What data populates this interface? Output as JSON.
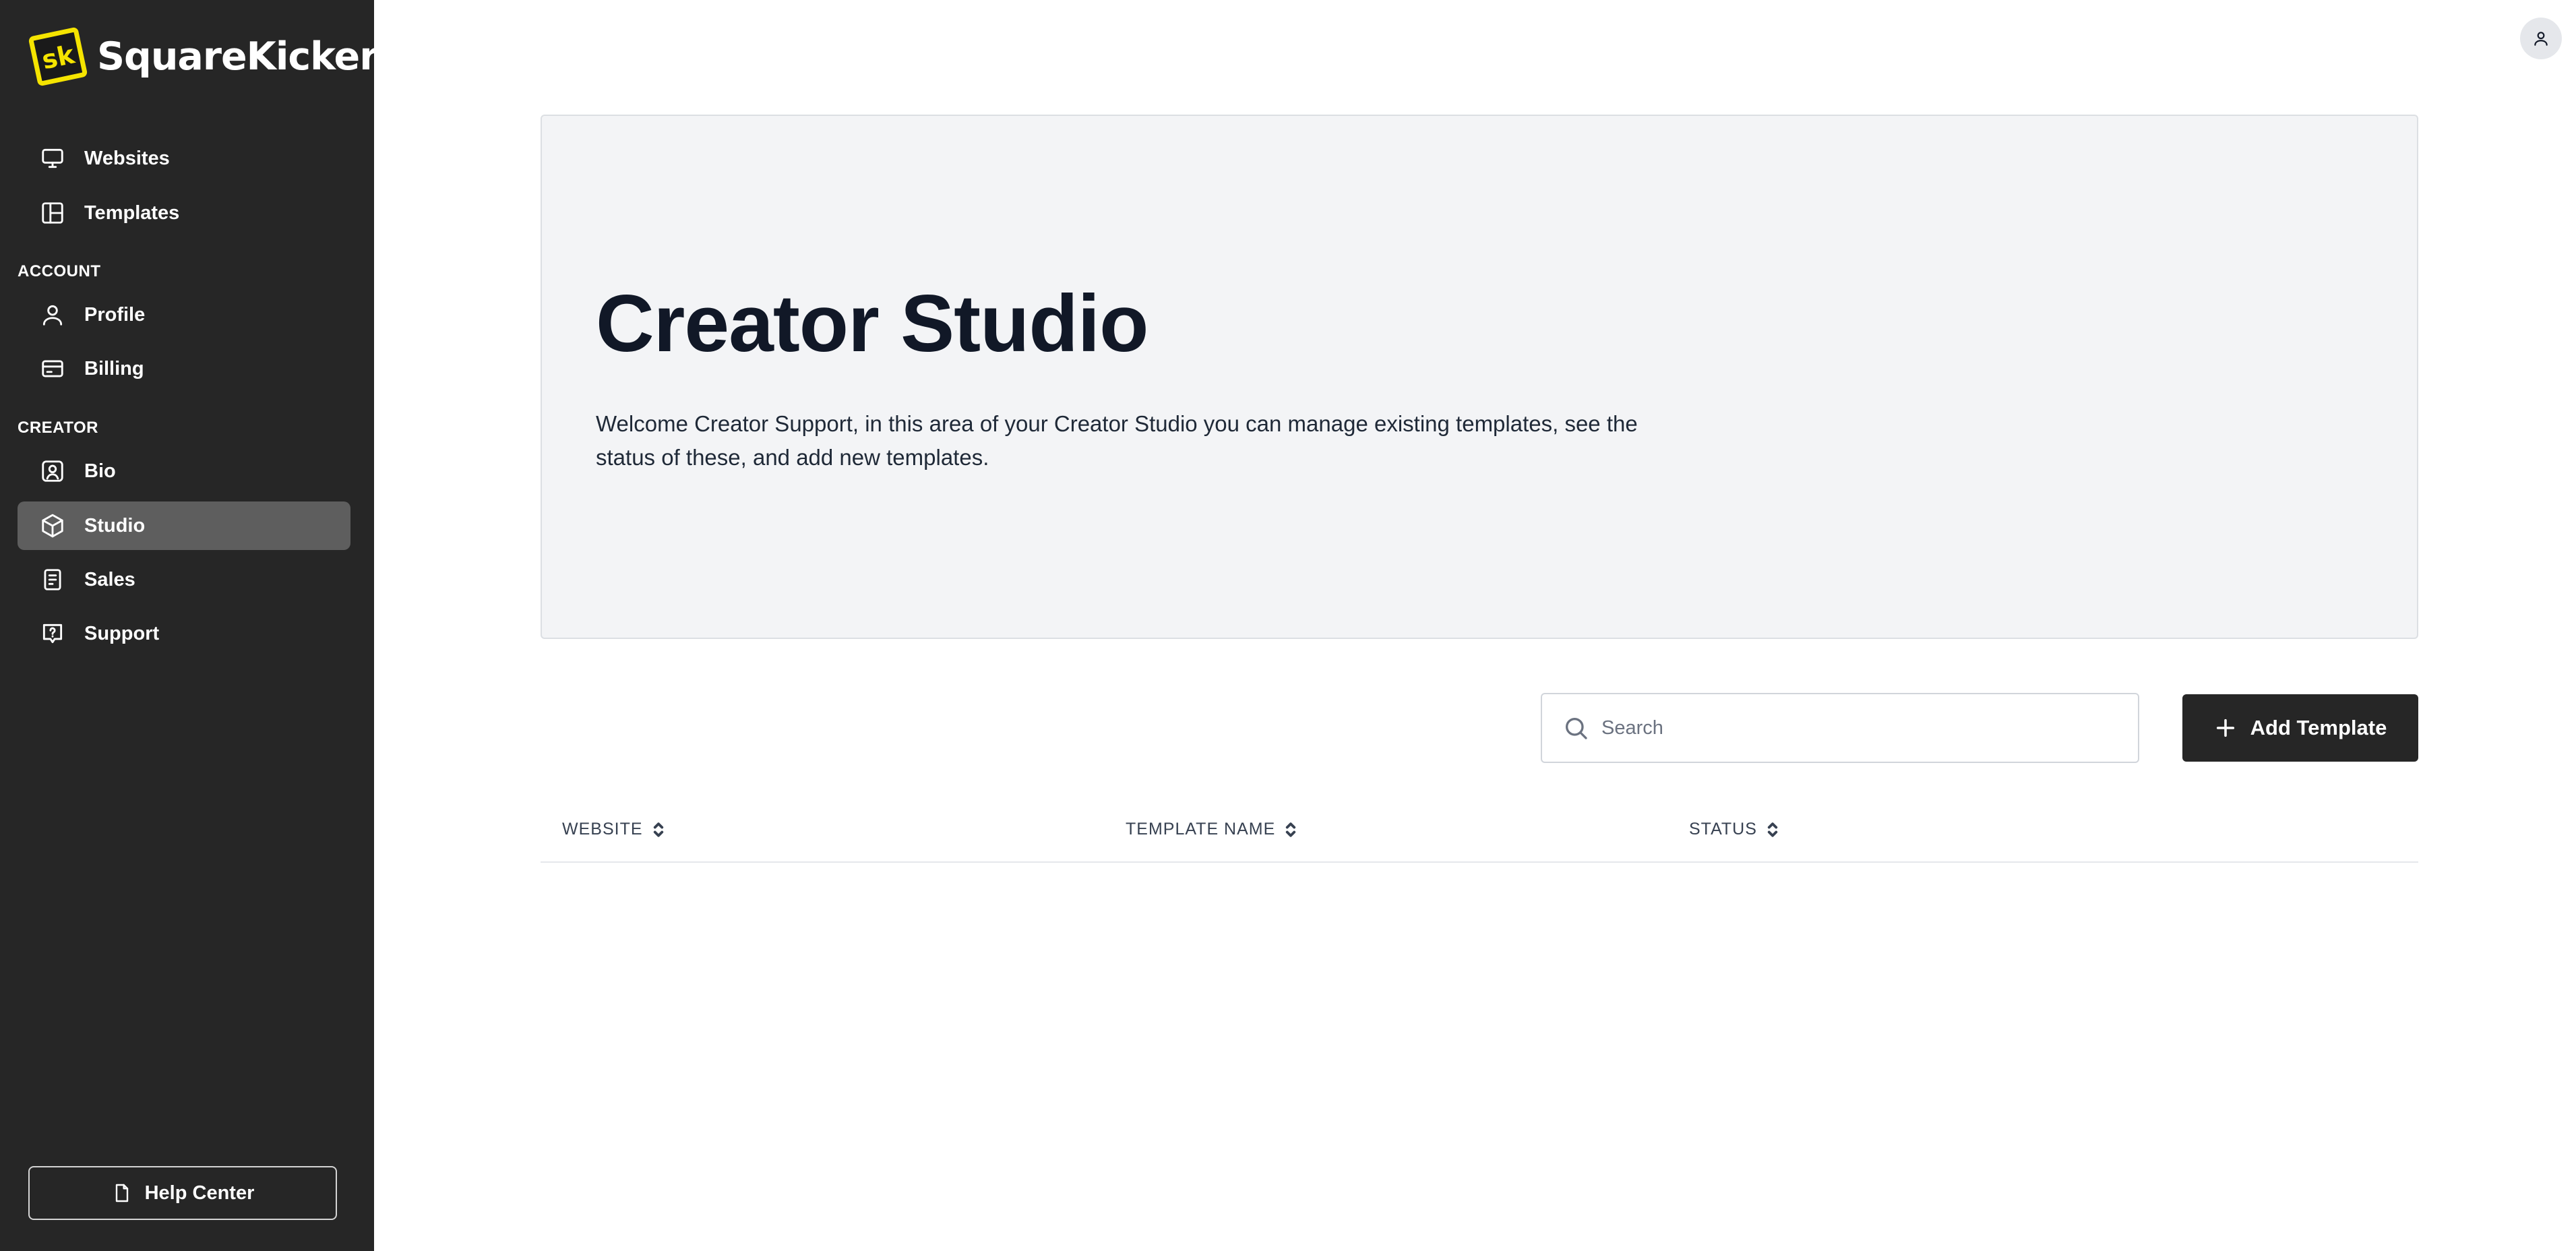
{
  "brand": {
    "name": "SquareKicker",
    "logo_mark_text": "sk",
    "accent_color": "#f5e400"
  },
  "sidebar": {
    "main_items": [
      {
        "label": "Websites",
        "icon": "monitor-icon"
      },
      {
        "label": "Templates",
        "icon": "layout-icon"
      }
    ],
    "account_section": "ACCOUNT",
    "account_items": [
      {
        "label": "Profile",
        "icon": "user-icon"
      },
      {
        "label": "Billing",
        "icon": "credit-card-icon"
      }
    ],
    "creator_section": "CREATOR",
    "creator_items": [
      {
        "label": "Bio",
        "icon": "user-square-icon"
      },
      {
        "label": "Studio",
        "icon": "cube-icon",
        "active": true
      },
      {
        "label": "Sales",
        "icon": "receipt-icon"
      },
      {
        "label": "Support",
        "icon": "help-message-icon"
      }
    ],
    "help_center": {
      "label": "Help Center",
      "icon": "file-icon"
    }
  },
  "header": {
    "avatar_icon": "user-icon"
  },
  "hero": {
    "title": "Creator Studio",
    "description": "Welcome Creator Support, in this area of your Creator Studio you can manage existing templates, see the status of these, and add new templates."
  },
  "toolbar": {
    "search_placeholder": "Search",
    "search_value": "",
    "add_button_label": "Add Template"
  },
  "table": {
    "columns": [
      "WEBSITE",
      "TEMPLATE NAME",
      "STATUS"
    ],
    "rows": []
  }
}
